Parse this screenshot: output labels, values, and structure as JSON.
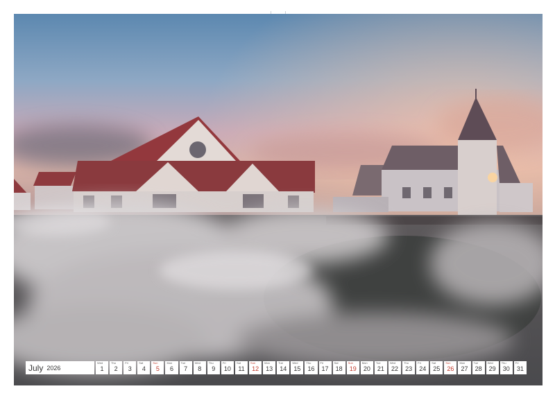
{
  "calendar": {
    "month": "July",
    "year": "2026",
    "days": [
      {
        "wd": "Wed",
        "n": "1"
      },
      {
        "wd": "Thu",
        "n": "2"
      },
      {
        "wd": "Fri",
        "n": "3"
      },
      {
        "wd": "Sat",
        "n": "4"
      },
      {
        "wd": "Sun",
        "n": "5",
        "sun": true
      },
      {
        "wd": "Mon",
        "n": "6"
      },
      {
        "wd": "Tue",
        "n": "7"
      },
      {
        "wd": "Wed",
        "n": "8"
      },
      {
        "wd": "Thu",
        "n": "9"
      },
      {
        "wd": "Fri",
        "n": "10"
      },
      {
        "wd": "Sat",
        "n": "11"
      },
      {
        "wd": "Sun",
        "n": "12",
        "sun": true
      },
      {
        "wd": "Mon",
        "n": "13"
      },
      {
        "wd": "Tue",
        "n": "14"
      },
      {
        "wd": "Wed",
        "n": "15"
      },
      {
        "wd": "Thu",
        "n": "16"
      },
      {
        "wd": "Fri",
        "n": "17"
      },
      {
        "wd": "Sat",
        "n": "18"
      },
      {
        "wd": "Sun",
        "n": "19",
        "sun": true
      },
      {
        "wd": "Mon",
        "n": "20"
      },
      {
        "wd": "Tue",
        "n": "21"
      },
      {
        "wd": "Wed",
        "n": "22"
      },
      {
        "wd": "Thu",
        "n": "23"
      },
      {
        "wd": "Fri",
        "n": "24"
      },
      {
        "wd": "Sat",
        "n": "25"
      },
      {
        "wd": "Sun",
        "n": "26",
        "sun": true
      },
      {
        "wd": "Mon",
        "n": "27"
      },
      {
        "wd": "Tue",
        "n": "28"
      },
      {
        "wd": "Wed",
        "n": "29"
      },
      {
        "wd": "Thu",
        "n": "30"
      },
      {
        "wd": "Fri",
        "n": "31"
      }
    ]
  },
  "colors": {
    "sunday": "#c0392b",
    "roof": "#8e3a3e",
    "steam": "#d9d6d8"
  }
}
